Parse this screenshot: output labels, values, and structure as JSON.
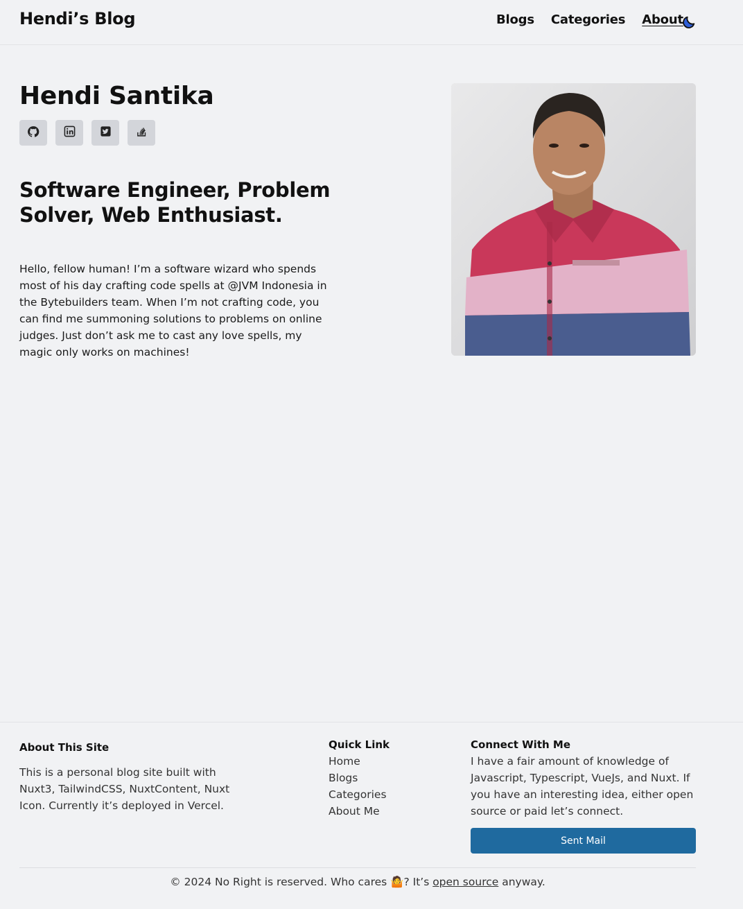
{
  "header": {
    "brand": "Hendi’s Blog",
    "nav": [
      {
        "label": "Blogs",
        "active": false
      },
      {
        "label": "Categories",
        "active": false
      },
      {
        "label": "About",
        "active": true
      }
    ],
    "theme_icon": "moon-icon"
  },
  "hero": {
    "name": "Hendi Santika",
    "socials": [
      {
        "icon": "github-icon"
      },
      {
        "icon": "linkedin-icon"
      },
      {
        "icon": "twitter-icon"
      },
      {
        "icon": "stackoverflow-icon"
      }
    ],
    "tagline": "Software Engineer, Problem Solver, Web Enthusiast.",
    "bio": "Hello, fellow human! I’m a software wizard who spends most of his day crafting code spells at @JVM Indonesia in the Bytebuilders team. When I’m not crafting code, you can find me summoning solutions to problems on online judges. Just don’t ask me to cast any love spells, my magic only works on machines!"
  },
  "footer": {
    "about_title": "About This Site",
    "about_text": "This is a personal blog site built with Nuxt3, TailwindCSS, NuxtContent, Nuxt Icon. Currently it’s deployed in Vercel.",
    "quick_title": "Quick Link",
    "quick_links": [
      "Home",
      "Blogs",
      "Categories",
      "About Me"
    ],
    "connect_title": "Connect With Me",
    "connect_text": "I have a fair amount of knowledge of Javascript, Typescript, VueJs, and Nuxt. If you have an interesting idea, either open source or paid let’s connect.",
    "mail_button": "Sent Mail",
    "copyright_prefix": "© 2024 No Right is reserved. Who cares ",
    "copyright_emoji": "🤷",
    "copyright_mid": "? It’s ",
    "copyright_link": "open source",
    "copyright_suffix": " anyway."
  },
  "colors": {
    "background": "#f1f2f4",
    "accent_button": "#1f6a9f",
    "social_bg": "#d3d5da",
    "moon_icon": "#2f5fd8"
  }
}
